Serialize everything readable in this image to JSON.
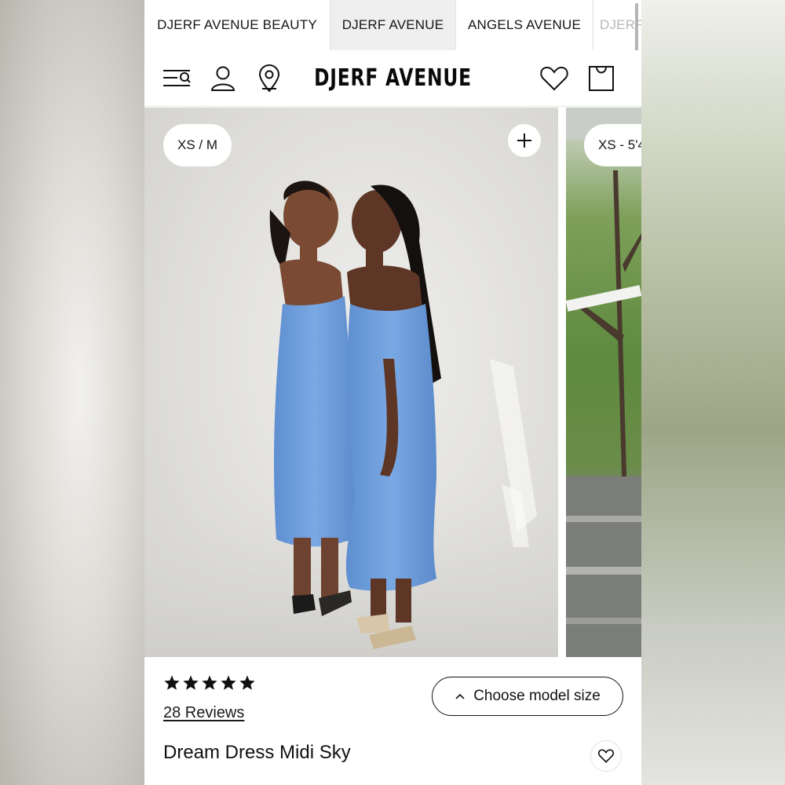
{
  "tabs": [
    {
      "label": "DJERF AVENUE BEAUTY",
      "active": false
    },
    {
      "label": "DJERF AVENUE",
      "active": true
    },
    {
      "label": "ANGELS AVENUE",
      "active": false
    },
    {
      "label": "DJERF",
      "active": false
    }
  ],
  "header": {
    "logo": "DJERF AVENUE",
    "icons": [
      "search-menu-icon",
      "account-icon",
      "location-icon",
      "wishlist-heart-icon",
      "cart-bag-icon"
    ]
  },
  "gallery": {
    "images": [
      {
        "size_label": "XS / M",
        "alt": "Two models in sky blue satin midi dresses"
      },
      {
        "size_label": "XS - 5'4",
        "alt": "Model outdoors near greenery and deck"
      }
    ],
    "expand_icon": "plus-icon"
  },
  "product": {
    "rating": 5,
    "reviews_label": "28 Reviews",
    "choose_size_label": "Choose model size",
    "title": "Dream Dress Midi Sky"
  },
  "colors": {
    "dress": "#6f9fdc",
    "text": "#111111",
    "background": "#ffffff"
  }
}
